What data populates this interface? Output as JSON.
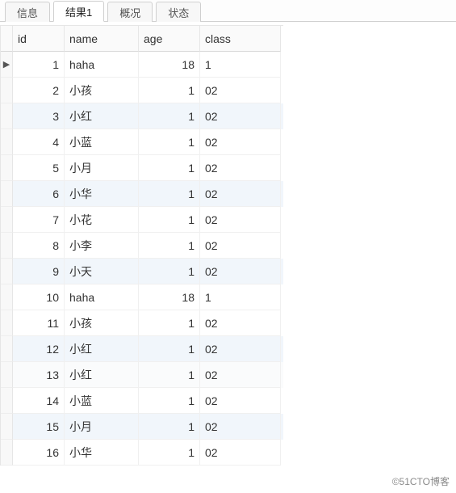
{
  "tabs": {
    "items": [
      {
        "label": "信息"
      },
      {
        "label": "结果1"
      },
      {
        "label": "概况"
      },
      {
        "label": "状态"
      }
    ],
    "active_index": 1
  },
  "grid": {
    "columns": {
      "id": "id",
      "name": "name",
      "age": "age",
      "class": "class"
    },
    "current_row_marker": "▶",
    "rows": [
      {
        "id": "1",
        "name": "haha",
        "age": "18",
        "class": "1"
      },
      {
        "id": "2",
        "name": "小孩",
        "age": "1",
        "class": "02"
      },
      {
        "id": "3",
        "name": "小红",
        "age": "1",
        "class": "02"
      },
      {
        "id": "4",
        "name": "小蓝",
        "age": "1",
        "class": "02"
      },
      {
        "id": "5",
        "name": "小月",
        "age": "1",
        "class": "02"
      },
      {
        "id": "6",
        "name": "小华",
        "age": "1",
        "class": "02"
      },
      {
        "id": "7",
        "name": "小花",
        "age": "1",
        "class": "02"
      },
      {
        "id": "8",
        "name": "小李",
        "age": "1",
        "class": "02"
      },
      {
        "id": "9",
        "name": "小天",
        "age": "1",
        "class": "02"
      },
      {
        "id": "10",
        "name": "haha",
        "age": "18",
        "class": "1"
      },
      {
        "id": "11",
        "name": "小孩",
        "age": "1",
        "class": "02"
      },
      {
        "id": "12",
        "name": "小红",
        "age": "1",
        "class": "02"
      },
      {
        "id": "13",
        "name": "小红",
        "age": "1",
        "class": "02"
      },
      {
        "id": "14",
        "name": "小蓝",
        "age": "1",
        "class": "02"
      },
      {
        "id": "15",
        "name": "小月",
        "age": "1",
        "class": "02"
      },
      {
        "id": "16",
        "name": "小华",
        "age": "1",
        "class": "02"
      }
    ],
    "highlight_rows": [
      2,
      5,
      8,
      11,
      14
    ],
    "light_rows": [
      12
    ]
  },
  "watermark": "©51CTO博客"
}
